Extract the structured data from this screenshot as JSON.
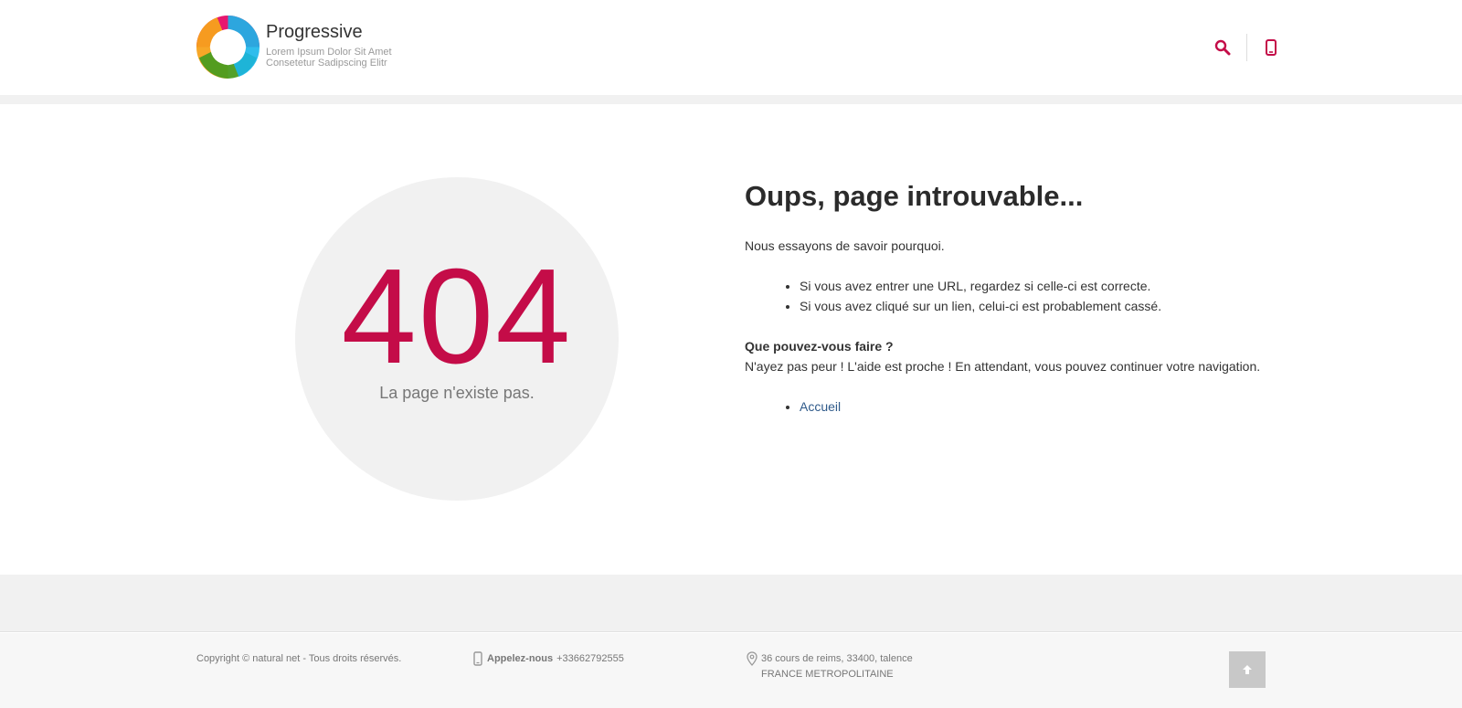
{
  "header": {
    "site_name": "Progressive",
    "slogan": "Lorem Ipsum Dolor Sit Amet Consetetur Sadipscing Elitr",
    "logo_icon": "multicolor-ring-logo",
    "icons": [
      "search-icon",
      "mobile-phone-icon"
    ],
    "accent_color": "#c40c48"
  },
  "error": {
    "code": "404",
    "subtitle": "La page n'existe pas.",
    "title": "Oups, page introuvable...",
    "intro": "Nous essayons de savoir pourquoi.",
    "reasons": [
      "Si vous avez entrer une URL, regardez si celle-ci est correcte.",
      "Si vous avez cliqué sur un lien, celui-ci est probablement cassé."
    ],
    "help_heading": "Que pouvez-vous faire ?",
    "help_text": "N'ayez pas peur ! L'aide est proche ! En attendant, vous pouvez continuer votre navigation.",
    "links": [
      "Accueil"
    ]
  },
  "footer": {
    "copyright": "Copyright © natural net - Tous droits réservés.",
    "phone_label": "Appelez-nous",
    "phone_number": "+33662792555",
    "address_line1": "36 cours de reims, 33400, talence",
    "address_line2": "FRANCE METROPOLITAINE",
    "scroll_top_icon": "arrow-up-icon"
  }
}
